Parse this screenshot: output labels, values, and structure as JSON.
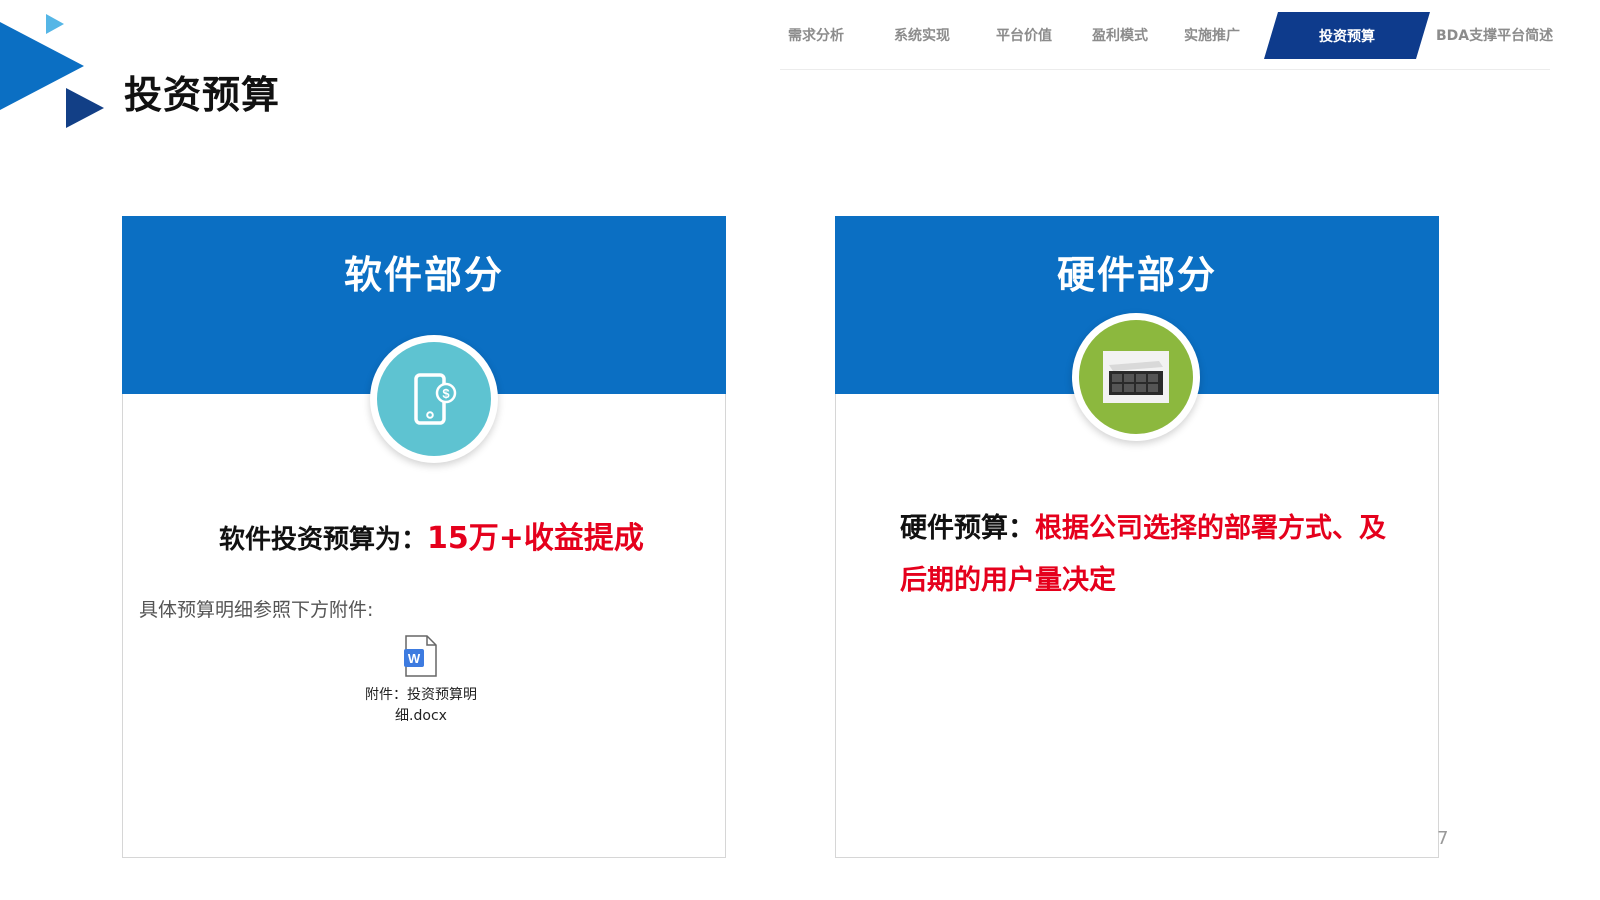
{
  "header": {
    "title": "投资预算",
    "nav": [
      "需求分析",
      "系统实现",
      "平台价值",
      "盈利模式",
      "实施推广",
      "投资预算",
      "BDA支撑平台简述"
    ],
    "active_index": 5,
    "active_color": "#0e3b8c"
  },
  "software_card": {
    "title": "软件部分",
    "icon": "mobile-payment-icon",
    "budget_label": "软件投资预算为：",
    "budget_value": "15万+收益提成",
    "detail_note": "具体预算明细参照下方附件:",
    "attachment": {
      "icon": "word-document-icon",
      "line1": "附件：投资预算明",
      "line2": "细.docx"
    }
  },
  "hardware_card": {
    "title": "硬件部分",
    "icon": "server-icon",
    "budget_label": "硬件预算：",
    "budget_value": "根据公司选择的部署方式、及后期的用户量决定"
  },
  "page_number": "7",
  "colors": {
    "header_blue": "#0b6fc3",
    "accent_red": "#e5001c",
    "software_circle": "#5ec3d1",
    "hardware_circle": "#8cb83e"
  }
}
